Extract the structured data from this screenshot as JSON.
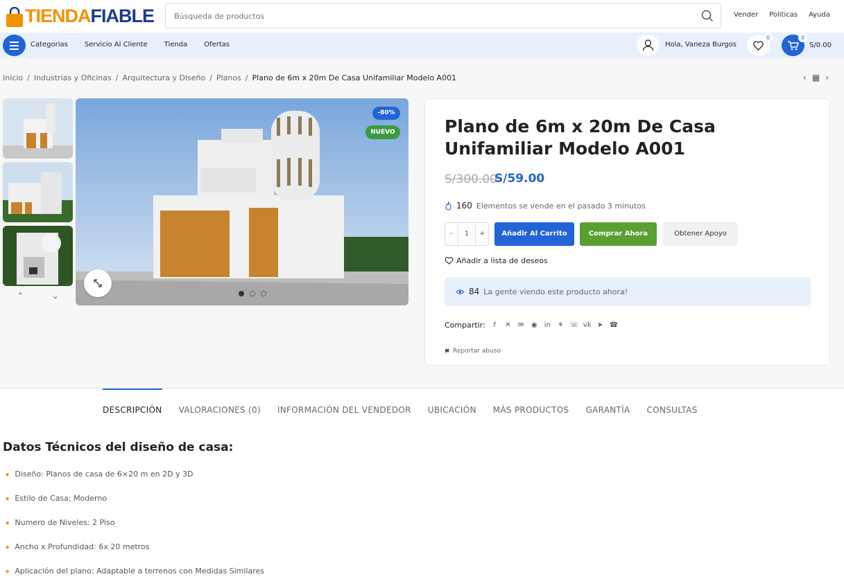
{
  "brand": {
    "part1": "TIENDA",
    "part2": "FIABLE"
  },
  "search": {
    "placeholder": "Búsqueda de productos"
  },
  "toplinks": [
    "Vender",
    "Politicas",
    "Ayuda"
  ],
  "nav": {
    "items": [
      "Categorias",
      "Servicio Al Cliente",
      "Tienda",
      "Ofertas"
    ]
  },
  "account": {
    "greeting": "Hola, Vaneza Burgos",
    "wishlist_count": "0",
    "cart_count": "0",
    "cart_total": "S/0.00"
  },
  "breadcrumbs": [
    "Inicio",
    "Industrias y Oficinas",
    "Arquitectura y Diseño",
    "Planos"
  ],
  "breadcrumb_current": "Plano de 6m x 20m De Casa Unifamiliar Modelo A001",
  "badges": {
    "sale": "-80%",
    "new": "NUEVO"
  },
  "product": {
    "title": "Plano de 6m x 20m De Casa Unifamiliar Modelo A001",
    "price_old": "S/300.00",
    "price_new": "S/59.00",
    "sold_count": "160",
    "sold_text": "Elementos se vende en el pasado 3 minutos",
    "qty": "1",
    "qty_minus": "-",
    "qty_plus": "+",
    "add_to_cart": "Añadir Al Carrito",
    "buy_now": "Comprar Ahora",
    "get_help": "Obtener Apoyo",
    "wishlist": "Añadir a lista de deseos",
    "viewers_count": "84",
    "viewers_text": "La gente viendo este producto ahora!",
    "share_label": "Compartir:",
    "report": "Reportar abuso"
  },
  "tabs": [
    "DESCRIPCIÓN",
    "VALORACIONES (0)",
    "INFORMACIÓN DEL VENDEDOR",
    "UBICACIÓN",
    "MÁS PRODUCTOS",
    "GARANTÍA",
    "CONSULTAS"
  ],
  "description": {
    "title": "Datos Técnicos del diseño de casa:",
    "specs": [
      "Diseño: Planos de casa de 6×20 m en 2D y 3D",
      "Estilo de Casa: Moderno",
      "Numero de Niveles: 2 Piso",
      "Ancho x Profundidad: 6x 20 metros",
      "Aplicación del plano: Adaptable a terrenos con Medidas Similares"
    ]
  },
  "colors": {
    "primary": "#2264d6",
    "accent": "#f39200",
    "green": "#5aa030"
  }
}
